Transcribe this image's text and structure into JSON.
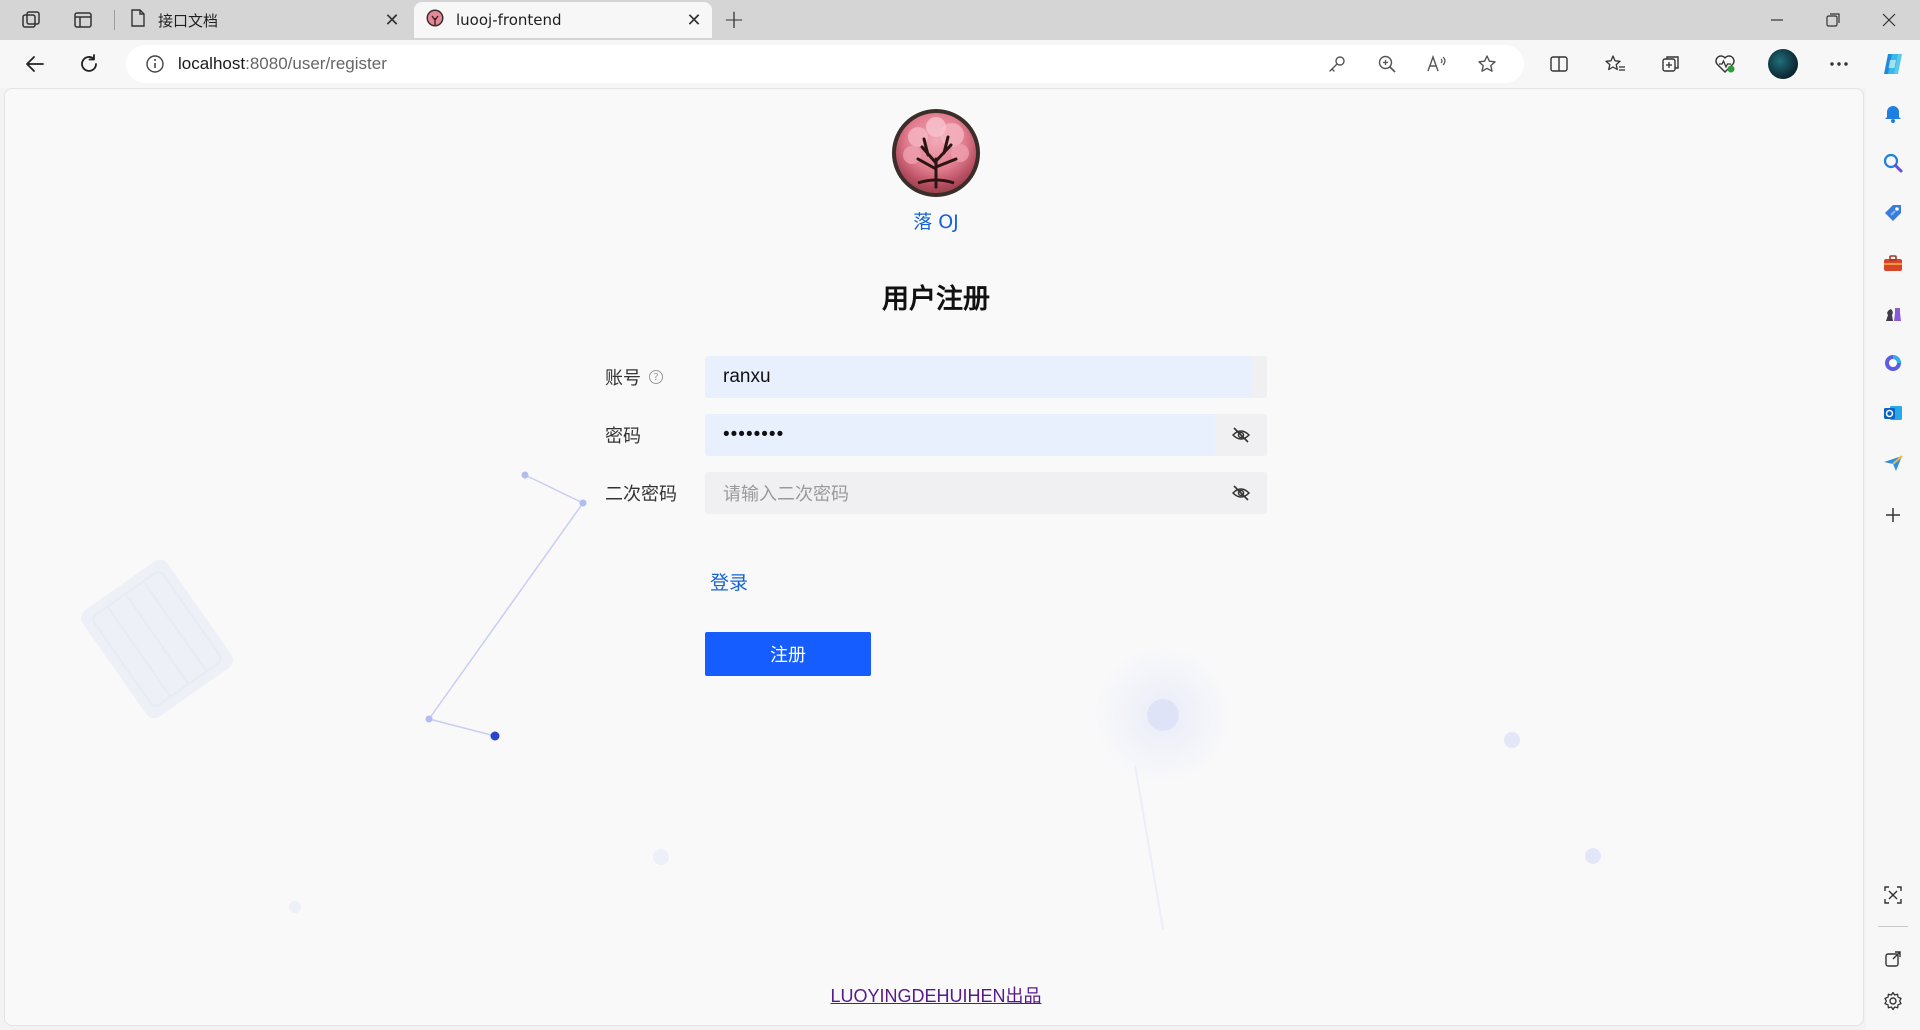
{
  "browser": {
    "tabs": [
      {
        "title": "接口文档",
        "icon": "document-icon",
        "active": false
      },
      {
        "title": "luooj-frontend",
        "icon": "site-favicon",
        "active": true
      }
    ],
    "address": {
      "host": "localhost",
      "path": ":8080/user/register"
    },
    "toolbar_icons": [
      "back-icon",
      "refresh-icon",
      "info-icon",
      "key-icon",
      "zoom-icon",
      "read-aloud-icon",
      "favorite-star-icon",
      "split-screen-icon",
      "favorites-icon",
      "collections-icon",
      "browser-essentials-icon",
      "profile-avatar",
      "more-icon",
      "copilot-icon"
    ],
    "sidebar_icons": [
      "bell-icon",
      "search-icon",
      "tag-icon",
      "toolbox-icon",
      "chess-icon",
      "office-icon",
      "outlook-icon",
      "send-icon",
      "add-icon",
      "screenshot-icon",
      "open-external-icon",
      "settings-icon"
    ]
  },
  "page": {
    "site_name": "落 OJ",
    "title": "用户注册",
    "fields": [
      {
        "label": "账号",
        "value": "ranxu",
        "placeholder": "",
        "has_help": true,
        "has_eye": false
      },
      {
        "label": "密码",
        "value": "••••••••",
        "placeholder": "",
        "has_help": false,
        "has_eye": true
      },
      {
        "label": "二次密码",
        "value": "",
        "placeholder": "请输入二次密码",
        "has_help": false,
        "has_eye": true
      }
    ],
    "login_link": "登录",
    "register_button": "注册",
    "footer": "LUOYINGDEHUIHEN出品"
  },
  "colors": {
    "primary": "#165dff",
    "link": "#1763d6",
    "visited_link": "#551a8b",
    "input_filled_bg": "#e8f0fe"
  }
}
